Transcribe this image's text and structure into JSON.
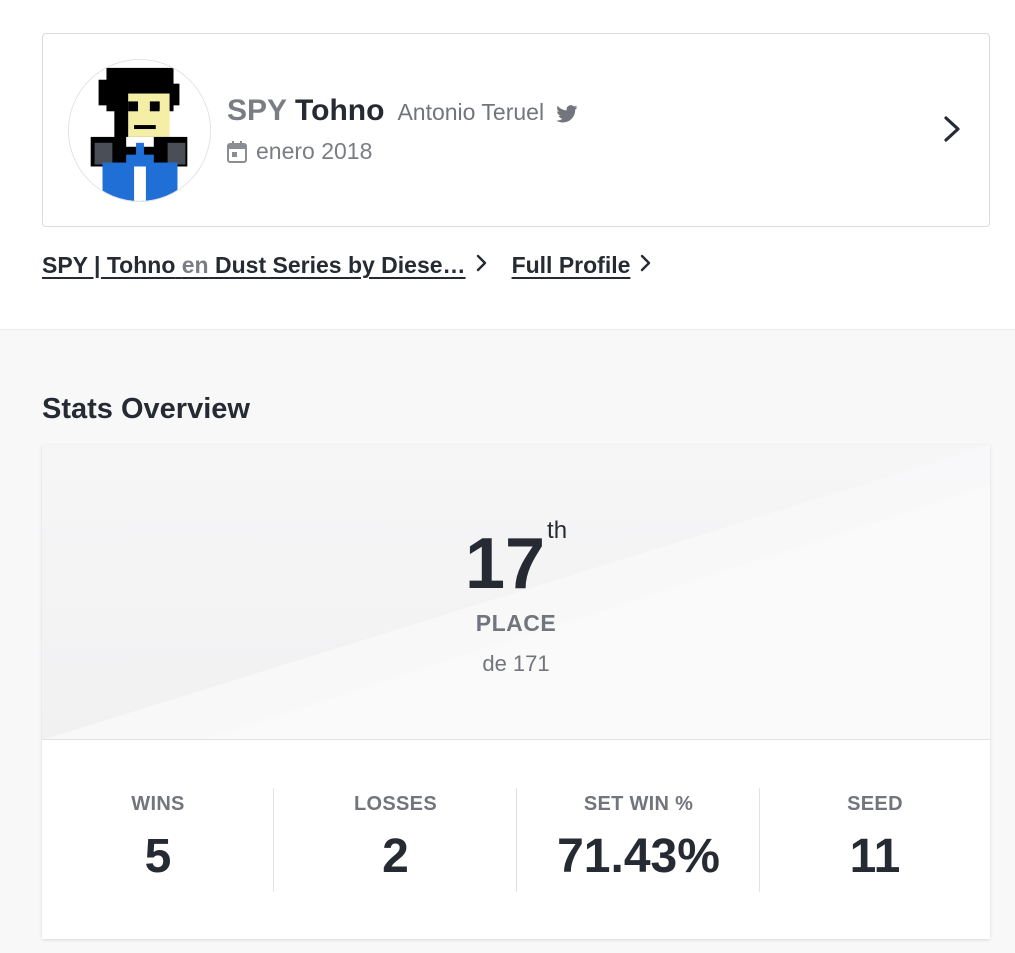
{
  "profile": {
    "prefix": "SPY",
    "gamer_tag": "Tohno",
    "real_name": "Antonio Teruel",
    "joined": "enero 2018",
    "avatar_icon": "pixel-character-avatar",
    "twitter_icon": "twitter-icon"
  },
  "links": {
    "event_player": "SPY | Tohno",
    "event_en": "en",
    "event_name": "Dust Series by Diese…",
    "full_profile": "Full Profile"
  },
  "stats": {
    "title": "Stats Overview",
    "place": "17",
    "place_suffix": "th",
    "place_label": "PLACE",
    "place_of": "de 171",
    "items": [
      {
        "label": "WINS",
        "value": "5"
      },
      {
        "label": "LOSSES",
        "value": "2"
      },
      {
        "label": "SET WIN %",
        "value": "71.43%"
      },
      {
        "label": "SEED",
        "value": "11"
      }
    ]
  },
  "colors": {
    "text_dark": "#262b33",
    "text_muted": "#72767c",
    "page_bg": "#f8f8f9",
    "card_border": "#dcdcdf"
  }
}
